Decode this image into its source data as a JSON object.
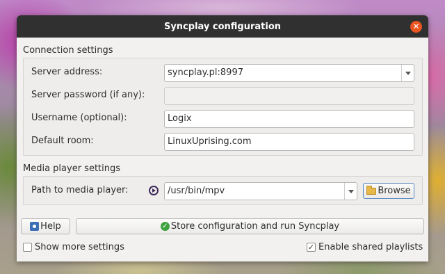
{
  "window": {
    "title": "Syncplay configuration"
  },
  "connection": {
    "section_label": "Connection settings",
    "server_address_label": "Server address:",
    "server_address_value": "syncplay.pl:8997",
    "server_password_label": "Server password (if any):",
    "server_password_value": "",
    "username_label": "Username (optional):",
    "username_value": "Logix",
    "default_room_label": "Default room:",
    "default_room_value": "LinuxUprising.com"
  },
  "media": {
    "section_label": "Media player settings",
    "path_label": "Path to media player:",
    "path_value": "/usr/bin/mpv",
    "browse_label": "Browse"
  },
  "actions": {
    "help_label": "Help",
    "store_label": "Store configuration and run Syncplay"
  },
  "options": {
    "show_more_label": "Show more settings",
    "show_more_checked": false,
    "shared_playlists_label": "Enable shared playlists",
    "shared_playlists_checked": true
  },
  "icons": {
    "close": "close-icon",
    "media_player": "play-icon",
    "help": "help-icon",
    "store": "check-circle-icon",
    "browse": "folder-icon"
  },
  "colors": {
    "titlebar": "#303030",
    "close_button": "#e95420",
    "ok_icon": "#3ea33e"
  }
}
